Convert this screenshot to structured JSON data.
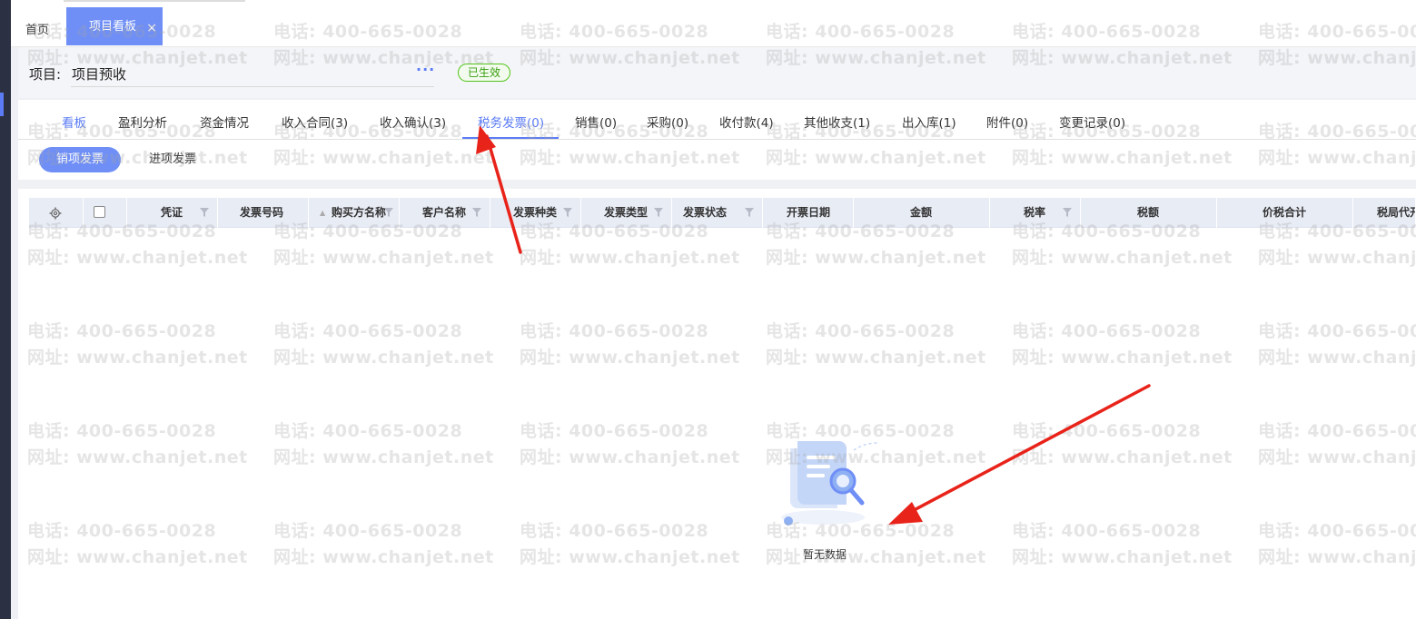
{
  "tabs": {
    "home": "首页",
    "active": "项目看板",
    "close": "×"
  },
  "project": {
    "label": "项目:",
    "name": "项目预收",
    "more": "···",
    "status": "已生效"
  },
  "subtabs": [
    {
      "label": "看板"
    },
    {
      "label": "盈利分析"
    },
    {
      "label": "资金情况"
    },
    {
      "label": "收入合同(3)"
    },
    {
      "label": "收入确认(3)"
    },
    {
      "label": "税务发票(0)"
    },
    {
      "label": "销售(0)"
    },
    {
      "label": "采购(0)"
    },
    {
      "label": "收付款(4)"
    },
    {
      "label": "其他收支(1)"
    },
    {
      "label": "出入库(1)"
    },
    {
      "label": "附件(0)"
    },
    {
      "label": "变更记录(0)"
    }
  ],
  "invoice_toggle": {
    "sales": "销项发票",
    "purchase": "进项发票"
  },
  "table": {
    "columns": [
      {
        "label": "凭证"
      },
      {
        "label": "发票号码"
      },
      {
        "label": "购买方名称"
      },
      {
        "label": "客户名称"
      },
      {
        "label": "发票种类"
      },
      {
        "label": "发票类型"
      },
      {
        "label": "发票状态"
      },
      {
        "label": "开票日期"
      },
      {
        "label": "金额"
      },
      {
        "label": "税率"
      },
      {
        "label": "税额"
      },
      {
        "label": "价税合计"
      },
      {
        "label": "税局代开"
      }
    ],
    "empty_text": "暂无数据"
  },
  "watermark": {
    "phone": "电话: 400-665-0028",
    "site": "网址: www.chanjet.net"
  },
  "colors": {
    "accent": "#5b7cf6",
    "status_green": "#52c41a",
    "arrow_red": "#e8231a"
  }
}
